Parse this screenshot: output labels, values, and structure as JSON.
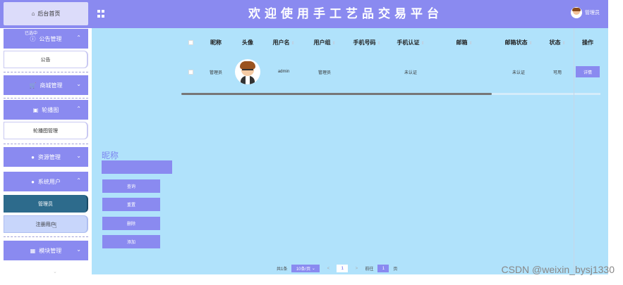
{
  "header": {
    "home_label": "后台首页",
    "title": "欢迎使用手工艺品交易平台",
    "user_label": "管理员"
  },
  "sidebar": {
    "top_tiny_text": "已选中",
    "groups": [
      {
        "label": "公告管理",
        "icon": "info-circle-icon",
        "expanded": true,
        "items": [
          {
            "label": "公告",
            "state": "normal"
          }
        ]
      },
      {
        "label": "商城管理",
        "icon": "cart-icon",
        "expanded": false,
        "items": []
      },
      {
        "label": "轮播图",
        "icon": "image-icon",
        "expanded": true,
        "items": [
          {
            "label": "轮播图管理",
            "state": "normal"
          }
        ]
      },
      {
        "label": "资源管理",
        "icon": "pin-icon",
        "expanded": false,
        "items": []
      },
      {
        "label": "系统用户",
        "icon": "person-icon",
        "expanded": true,
        "items": [
          {
            "label": "管理员",
            "state": "active"
          },
          {
            "label": "注册用户",
            "state": "hover"
          }
        ]
      },
      {
        "label": "模块管理",
        "icon": "grid-icon",
        "expanded": false,
        "items": []
      }
    ]
  },
  "search": {
    "label": "昵称",
    "input_value": "",
    "buttons": [
      "查询",
      "重置",
      "删除",
      "添加"
    ]
  },
  "table": {
    "columns": [
      {
        "label": "",
        "sortable": false
      },
      {
        "label": "昵称",
        "sortable": false
      },
      {
        "label": "头像",
        "sortable": false
      },
      {
        "label": "用户名",
        "sortable": true
      },
      {
        "label": "用户组",
        "sortable": true
      },
      {
        "label": "手机号码",
        "sortable": true
      },
      {
        "label": "手机认证",
        "sortable": true
      },
      {
        "label": "邮箱",
        "sortable": true
      },
      {
        "label": "邮箱状态",
        "sortable": true
      },
      {
        "label": "状态",
        "sortable": true
      },
      {
        "label": "操作",
        "sortable": false
      }
    ],
    "rows": [
      {
        "nickname": "管理员",
        "username": "admin",
        "group": "管理员",
        "phone": "",
        "phone_verify": "未认证",
        "email": "",
        "email_status": "未认证",
        "status": "可用",
        "action": "详情"
      }
    ]
  },
  "pagination": {
    "total_text": "共1条",
    "page_size": "10条/页",
    "prev": "<",
    "current": "1",
    "next": ">",
    "goto_label": "前往",
    "goto_value": "1",
    "page_suffix": "页"
  },
  "watermark": "CSDN @weixin_bysj1330",
  "colors": {
    "accent": "#8a8af0",
    "content_bg": "#b0e2fb",
    "active_item": "#2d6b8c"
  }
}
